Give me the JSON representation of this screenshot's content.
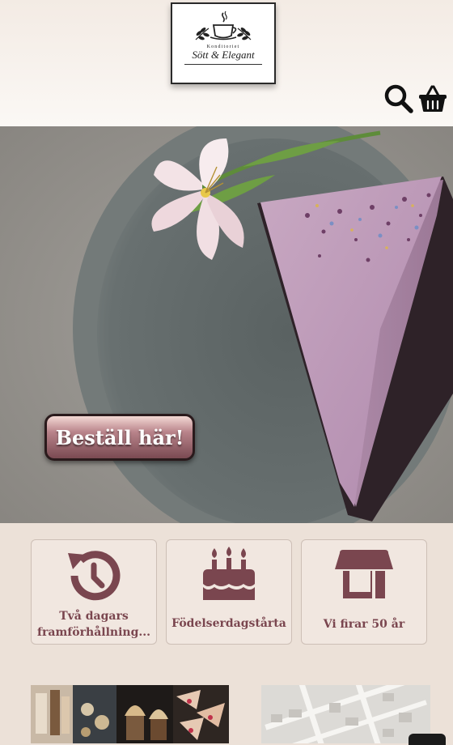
{
  "header": {
    "logo": {
      "top_text": "Konditoriet",
      "name": "Sött & Elegant"
    },
    "icons": {
      "search": "search-icon",
      "cart": "shopping-basket-icon"
    }
  },
  "hero": {
    "image": "purple-cheesecake-slice-with-flower",
    "cta_label": "Beställ här!"
  },
  "cards": [
    {
      "icon": "history-icon",
      "label": "Två dagars framförhållning..."
    },
    {
      "icon": "birthday-cake-icon",
      "label": "Födelserdagstårta"
    },
    {
      "icon": "store-icon",
      "label": "Vi firar 50 år"
    }
  ],
  "thumbnails": {
    "photos": "pastries-collage-image",
    "map": "map-image"
  },
  "colors": {
    "accent": "#7a464f",
    "background": "#ece1d8"
  }
}
